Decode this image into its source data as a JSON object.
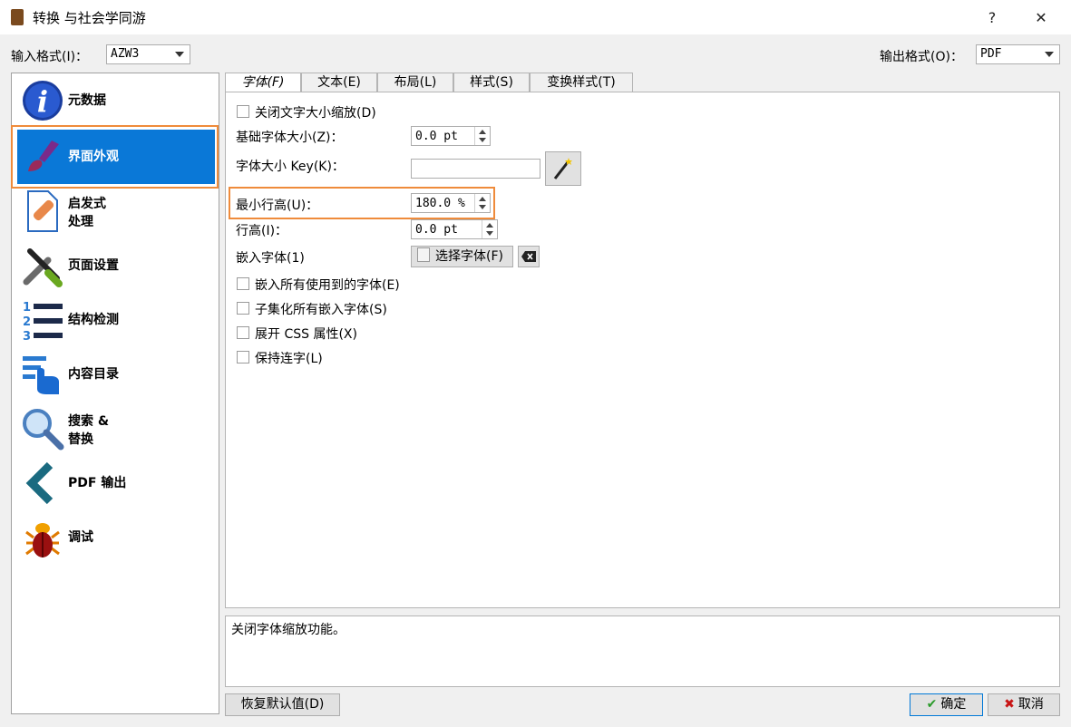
{
  "window": {
    "title": "转换 与社会学同游",
    "help": "?",
    "close": "✕"
  },
  "input_format": {
    "label": "输入格式(I)：",
    "value": "AZW3"
  },
  "output_format": {
    "label": "输出格式(O)：",
    "value": "PDF"
  },
  "sidebar": {
    "items": [
      {
        "label": "元数据",
        "icon": "info-icon"
      },
      {
        "label": "界面外观",
        "icon": "brush-icon"
      },
      {
        "label": "启发式\n处理",
        "icon": "bandage-icon"
      },
      {
        "label": "页面设置",
        "icon": "wrench-screwdriver-icon"
      },
      {
        "label": "结构检测",
        "icon": "numbered-list-icon"
      },
      {
        "label": "内容目录",
        "icon": "toc-pointer-icon"
      },
      {
        "label": "搜索 &\n替换",
        "icon": "magnifier-icon"
      },
      {
        "label": "PDF 输出",
        "icon": "chevron-left-icon"
      },
      {
        "label": "调试",
        "icon": "bug-icon"
      }
    ]
  },
  "tabs": [
    "字体(F)",
    "文本(E)",
    "布局(L)",
    "样式(S)",
    "变换样式(T)"
  ],
  "form": {
    "disable_font_scaling": "关闭文字大小缩放(D)",
    "base_font_size_label": "基础字体大小(Z)：",
    "base_font_size_value": "0.0 pt",
    "font_size_key_label": "字体大小 Key(K)：",
    "font_size_key_value": "",
    "min_line_height_label": "最小行高(U)：",
    "min_line_height_value": "180.0 %",
    "line_height_label": "行高(I)：",
    "line_height_value": "0.0 pt",
    "embed_font_label": "嵌入字体(1)",
    "choose_font_button": "选择字体(F)",
    "embed_all_fonts": "嵌入所有使用到的字体(E)",
    "subset_fonts": "子集化所有嵌入字体(S)",
    "expand_css": "展开 CSS 属性(X)",
    "keep_ligatures": "保持连字(L)"
  },
  "description": "关闭字体缩放功能。",
  "footer": {
    "restore_defaults": "恢复默认值(D)",
    "ok": "确定",
    "cancel": "取消"
  },
  "colors": {
    "accent": "#0a78d7",
    "highlight": "#ef8b3b"
  }
}
